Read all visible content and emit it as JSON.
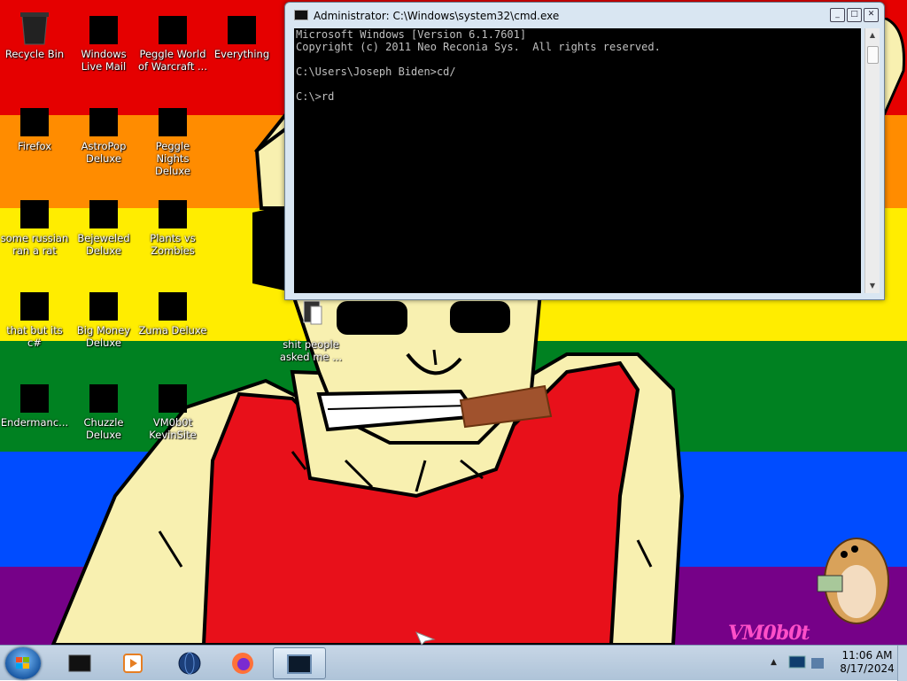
{
  "desktop": {
    "icons": [
      {
        "label": "Recycle Bin",
        "icon": "recycle-bin-icon"
      },
      {
        "label": "Windows Live Mail",
        "icon": "mail-icon"
      },
      {
        "label": "Peggle World of Warcraft ...",
        "icon": "peggle-wow-icon"
      },
      {
        "label": "Everything",
        "icon": "search-app-icon"
      },
      {
        "label": "Firefox",
        "icon": "firefox-icon"
      },
      {
        "label": "AstroPop Deluxe",
        "icon": "astropop-icon"
      },
      {
        "label": "Peggle Nights Deluxe",
        "icon": "peggle-nights-icon"
      },
      {
        "label": "some russian ran a rat",
        "icon": "game-icon"
      },
      {
        "label": "Bejeweled Deluxe",
        "icon": "bejeweled-icon"
      },
      {
        "label": "Plants vs Zombies",
        "icon": "pvz-icon"
      },
      {
        "label": "that but its c#",
        "icon": "file-icon"
      },
      {
        "label": "Big Money Deluxe",
        "icon": "money-bag-icon"
      },
      {
        "label": "Zuma Deluxe",
        "icon": "zuma-icon"
      },
      {
        "label": "shit people asked me ...",
        "icon": "text-file-icon"
      },
      {
        "label": "Endermanc...",
        "icon": "terminal-icon"
      },
      {
        "label": "Chuzzle Deluxe",
        "icon": "chuzzle-icon"
      },
      {
        "label": "VM0b0t KevinSite",
        "icon": "monitor-icon"
      }
    ],
    "watermark": "VM0b0t"
  },
  "cmd_window": {
    "title": "Administrator: C:\\Windows\\system32\\cmd.exe",
    "lines": [
      "Microsoft Windows [Version 6.1.7601]",
      "Copyright (c) 2011 Neo Reconia Sys.  All rights reserved.",
      "",
      "C:\\Users\\Joseph Biden>cd/",
      "",
      "C:\\>rd"
    ],
    "buttons": {
      "minimize": "_",
      "maximize": "□",
      "close": "✕"
    }
  },
  "taskbar": {
    "pinned": [
      "explorer-icon",
      "media-player-icon",
      "globe-icon",
      "firefox-icon",
      "cmd-icon"
    ],
    "clock_time": "11:06 AM",
    "clock_date": "8/17/2024"
  },
  "colors": {
    "rainbow": [
      "#e50000",
      "#ff8c00",
      "#ffed00",
      "#008121",
      "#004cff",
      "#760188"
    ],
    "skin": "#f8f0b0",
    "tank_top": "#e8101a"
  }
}
